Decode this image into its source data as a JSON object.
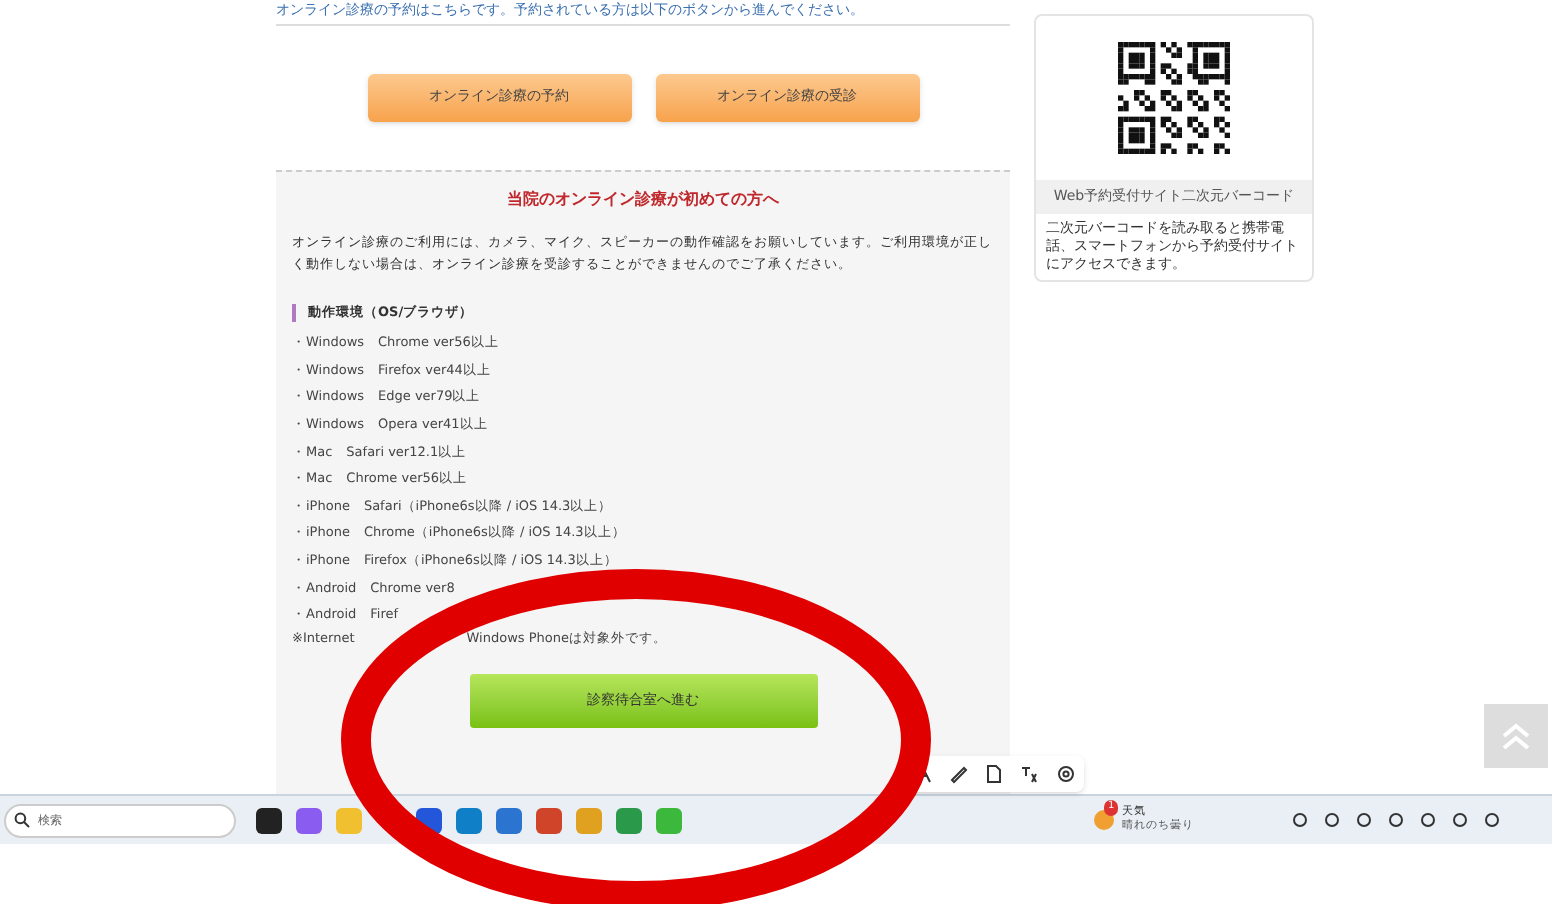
{
  "intro": "オンライン診療の予約はこちらです。予約されている方は以下のボタンから進んでください。",
  "buttons": [
    "オンライン診療の予約",
    "オンライン診療の受診"
  ],
  "first_time": {
    "heading": "当院のオンライン診療が初めての方へ",
    "body": "オンライン診療のご利用には、カメラ、マイク、スピーカーの動作確認をお願いしています。ご利用環境が正しく動作しない場合は、オンライン診療を受診することができませんのでご了承ください。",
    "section_title": "動作環境（OS/ブラウザ）",
    "environments": [
      "・Windows　Chrome ver56以上",
      "・Windows　Firefox ver44以上",
      "・Windows　Edge ver79以上",
      "・Windows　Opera ver41以上",
      "・Mac　Safari ver12.1以上",
      "・Mac　Chrome ver56以上",
      "・iPhone　Safari（iPhone6s以降 / iOS 14.3以上）",
      "・iPhone　Chrome（iPhone6s以降 / iOS 14.3以上）",
      "・iPhone　Firefox（iPhone6s以降 / iOS 14.3以上）",
      "・Android　Chrome ver8",
      "・Android　Firef"
    ],
    "note_parts": [
      "※Internet",
      "Windows Phoneは対象外です。"
    ],
    "enter_button": "診察待合室へ進む"
  },
  "qr_card": {
    "caption": "Web予約受付サイト二次元バーコード",
    "description": "二次元バーコードを読み取ると携帯電話、スマートフォンから予約受付サイトにアクセスできます。"
  },
  "taskbar": {
    "search_placeholder": "検索",
    "weather": {
      "badge": "1",
      "title": "天気",
      "detail": "晴れのち曇り"
    }
  }
}
